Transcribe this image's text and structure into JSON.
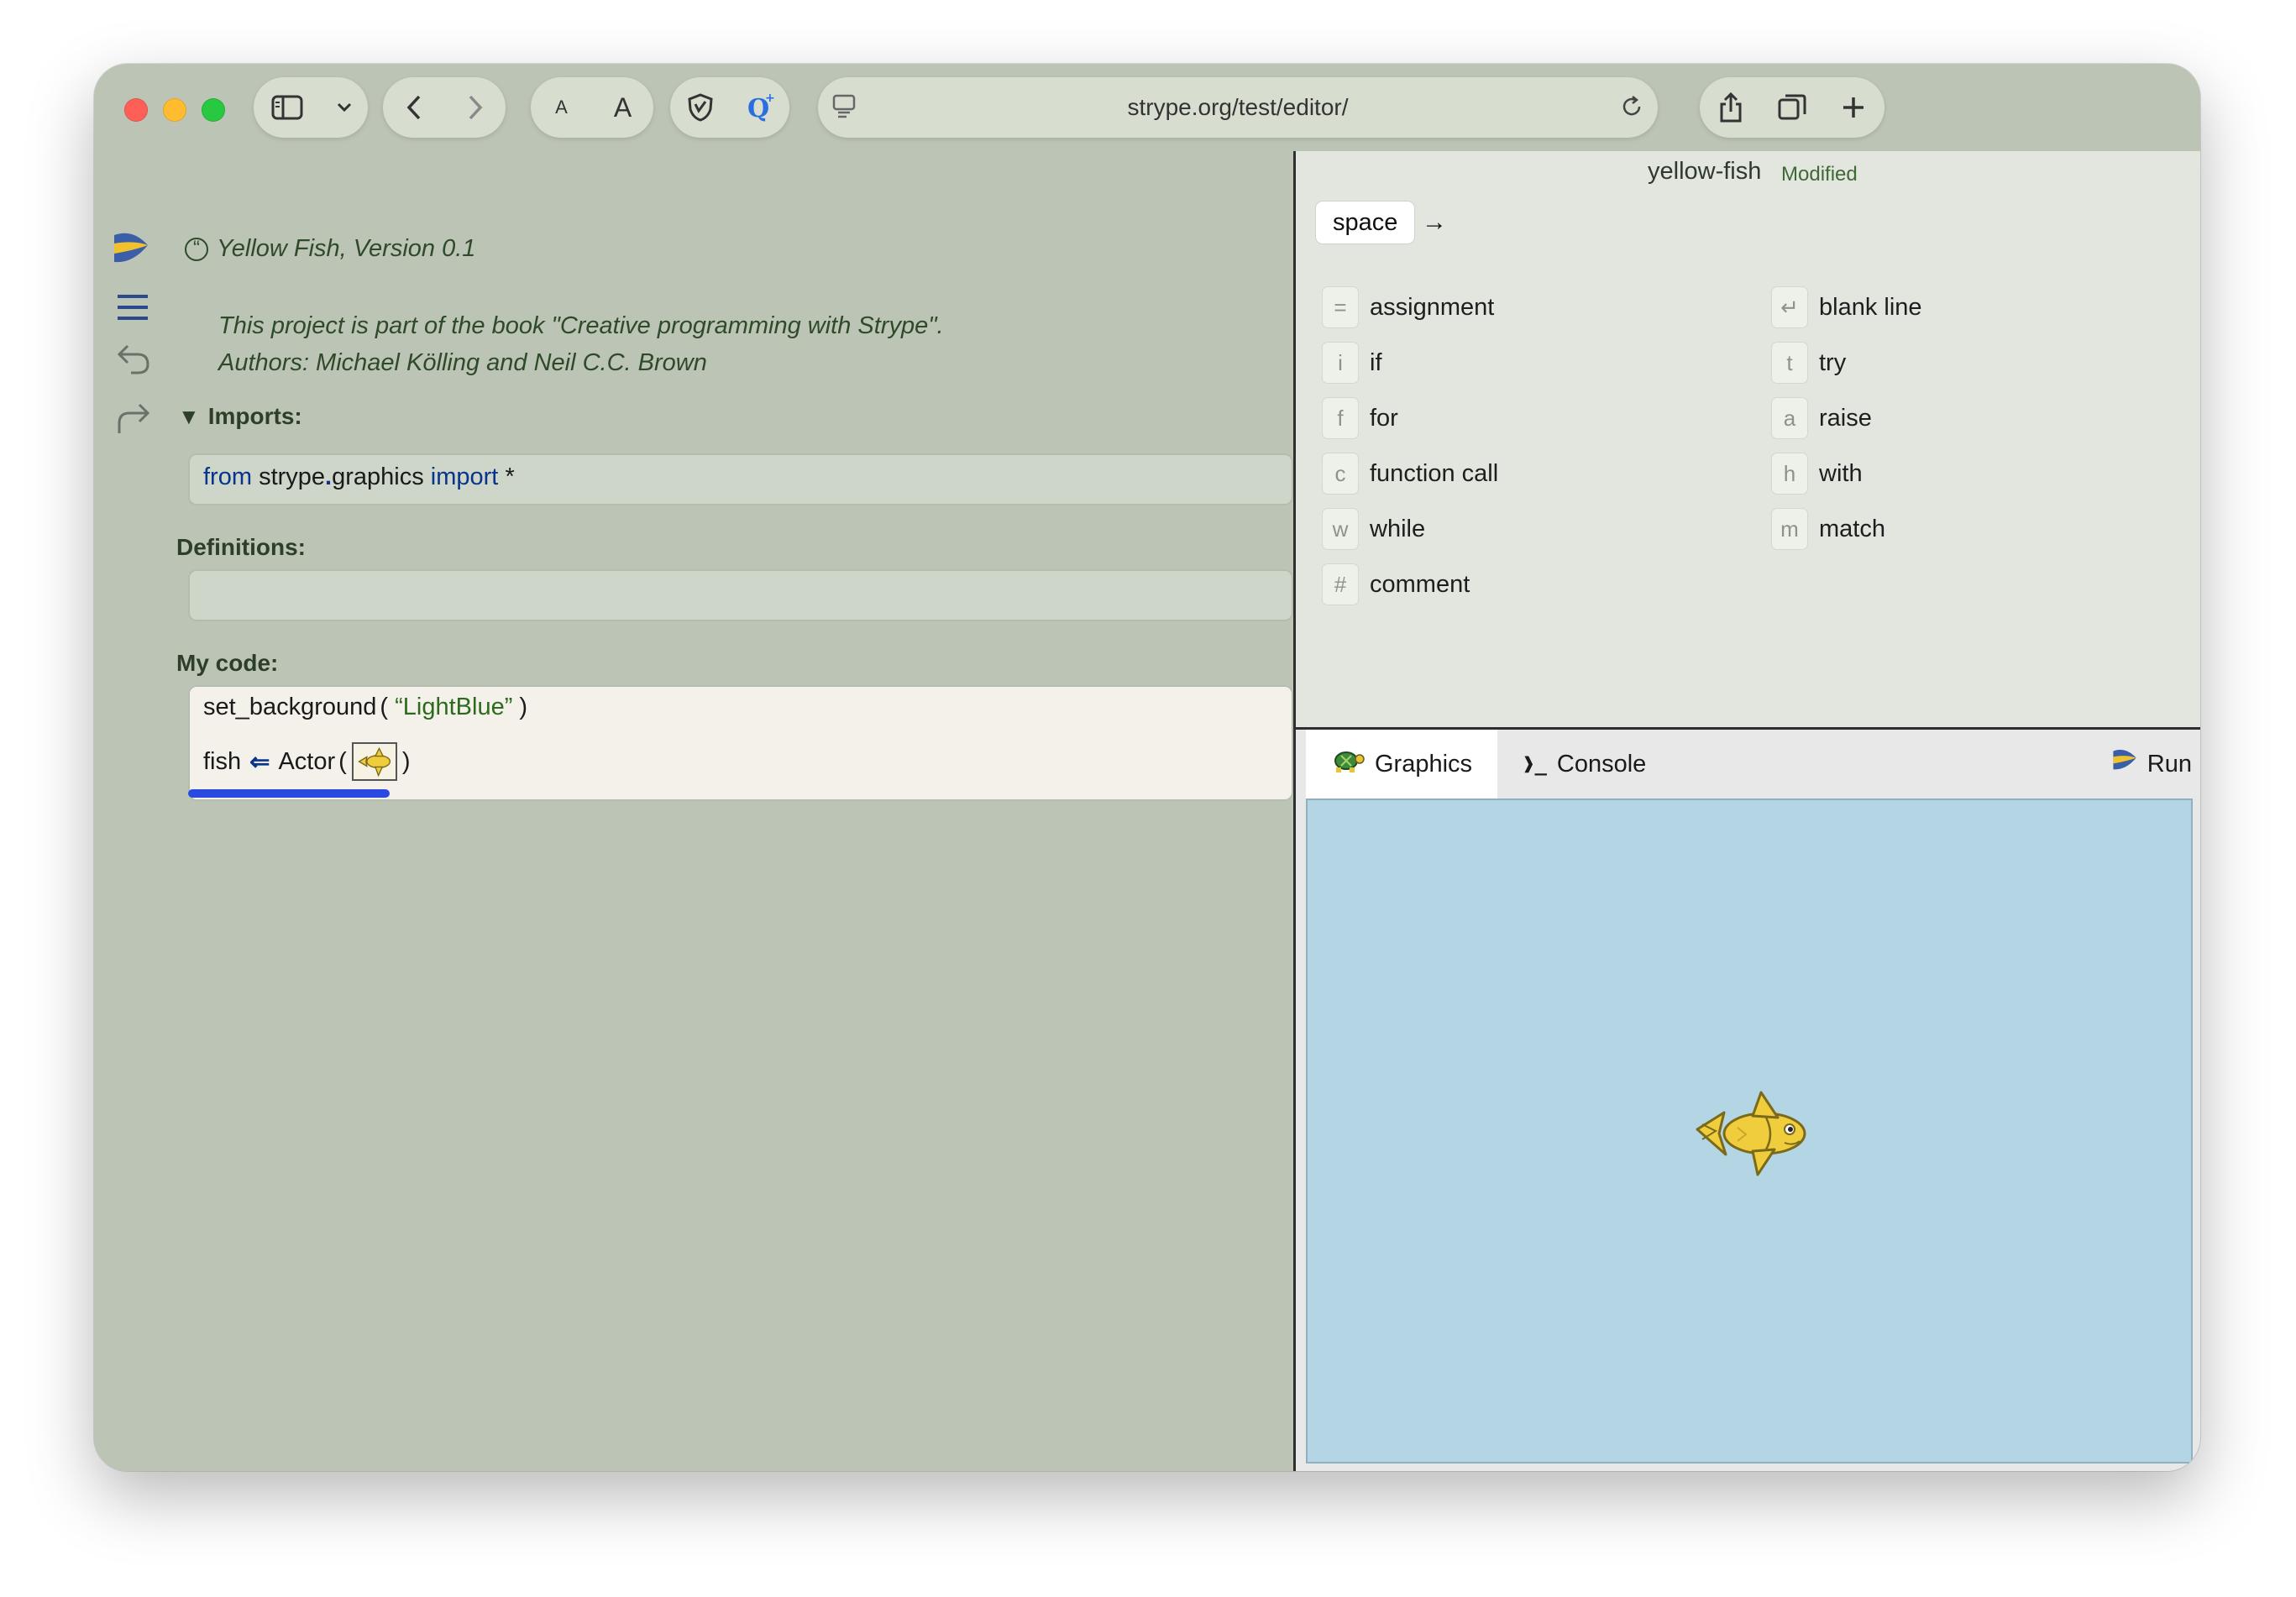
{
  "browser": {
    "url": "strype.org/test/editor/",
    "text_size_small": "A",
    "text_size_large": "A"
  },
  "editor": {
    "project_title": "Yellow Fish, Version 0.1",
    "description_line1": "This project is part of the book \"Creative programming with Strype\".",
    "description_line2": "Authors: Michael Kölling and Neil C.C. Brown",
    "imports_label": "Imports:",
    "imports_code": {
      "kw_from": "from",
      "module_a": "strype",
      "dot": ".",
      "module_b": "graphics",
      "kw_import": "import",
      "star": "*"
    },
    "definitions_label": "Definitions:",
    "mycode_label": "My code:",
    "line1": {
      "func": "set_background",
      "open": "(",
      "arg": "“LightBlue”",
      "close": ")"
    },
    "line2": {
      "var": "fish",
      "assign": "⇐",
      "func": "Actor",
      "open": "(",
      "close": ")"
    }
  },
  "catalog": {
    "project_name": "yellow-fish",
    "status": "Modified",
    "space_key": "space",
    "arrow": "→",
    "commands_left": [
      {
        "key": "=",
        "label": "assignment"
      },
      {
        "key": "i",
        "label": "if"
      },
      {
        "key": "f",
        "label": "for"
      },
      {
        "key": "c",
        "label": "function call"
      },
      {
        "key": "w",
        "label": "while"
      },
      {
        "key": "#",
        "label": "comment"
      }
    ],
    "commands_right": [
      {
        "key": "↵",
        "label": "blank line"
      },
      {
        "key": "t",
        "label": "try"
      },
      {
        "key": "a",
        "label": "raise"
      },
      {
        "key": "h",
        "label": "with"
      },
      {
        "key": "m",
        "label": "match"
      }
    ]
  },
  "output": {
    "tab_graphics": "Graphics",
    "tab_console": "Console",
    "console_prefix": "❱_",
    "run_label": "Run",
    "canvas_background": "#b4d6e4"
  },
  "icons": [
    "sidebar-toggle-icon",
    "chevron-down-icon",
    "back-icon",
    "forward-icon",
    "shield-icon",
    "search-extension-icon",
    "page-icon",
    "reload-icon",
    "share-icon",
    "tabs-icon",
    "plus-icon",
    "strype-logo",
    "menu-icon",
    "undo-icon",
    "redo-icon",
    "collapse-triangle-icon",
    "turtle-icon",
    "fish-sprite"
  ]
}
